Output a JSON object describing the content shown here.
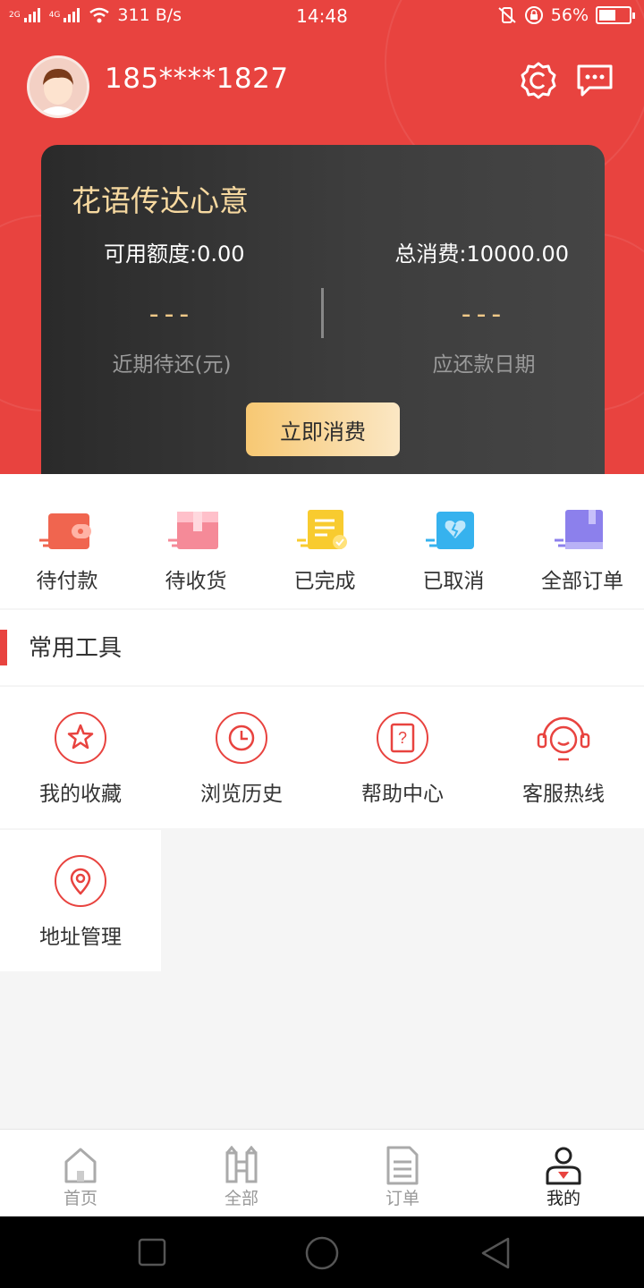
{
  "status_bar": {
    "network_tag_1": "2G",
    "network_tag_2": "4G",
    "speed": "311 B/s",
    "time": "14:48",
    "battery": "56%",
    "battery_level": 0.56
  },
  "profile": {
    "phone": "185****1827"
  },
  "card": {
    "title": "花语传达心意",
    "available_label": "可用额度:0.00",
    "total_label": "总消费:10000.00",
    "recent_due_value": "---",
    "recent_due_label": "近期待还(元)",
    "due_date_value": "---",
    "due_date_label": "应还款日期",
    "spend_button": "立即消费"
  },
  "orders": [
    {
      "label": "待付款",
      "icon": "wallet-icon",
      "color": "#f0654f"
    },
    {
      "label": "待收货",
      "icon": "package-icon",
      "color": "#f58a98"
    },
    {
      "label": "已完成",
      "icon": "document-check-icon",
      "color": "#f8cb2f"
    },
    {
      "label": "已取消",
      "icon": "broken-heart-icon",
      "color": "#36b2ee"
    },
    {
      "label": "全部订单",
      "icon": "book-icon",
      "color": "#8c80ec"
    }
  ],
  "tools_section": {
    "title": "常用工具",
    "items": [
      {
        "label": "我的收藏",
        "icon": "star-icon"
      },
      {
        "label": "浏览历史",
        "icon": "clock-icon"
      },
      {
        "label": "帮助中心",
        "icon": "help-book-icon"
      },
      {
        "label": "客服热线",
        "icon": "headset-icon"
      },
      {
        "label": "地址管理",
        "icon": "location-pin-icon"
      }
    ]
  },
  "tabbar": [
    {
      "label": "首页",
      "icon": "home-icon",
      "active": false
    },
    {
      "label": "全部",
      "icon": "gate-icon",
      "active": false
    },
    {
      "label": "订单",
      "icon": "document-icon",
      "active": false
    },
    {
      "label": "我的",
      "icon": "person-icon",
      "active": true
    }
  ],
  "colors": {
    "brand_red": "#e8433f",
    "card_gold": "#f7d9a0"
  }
}
